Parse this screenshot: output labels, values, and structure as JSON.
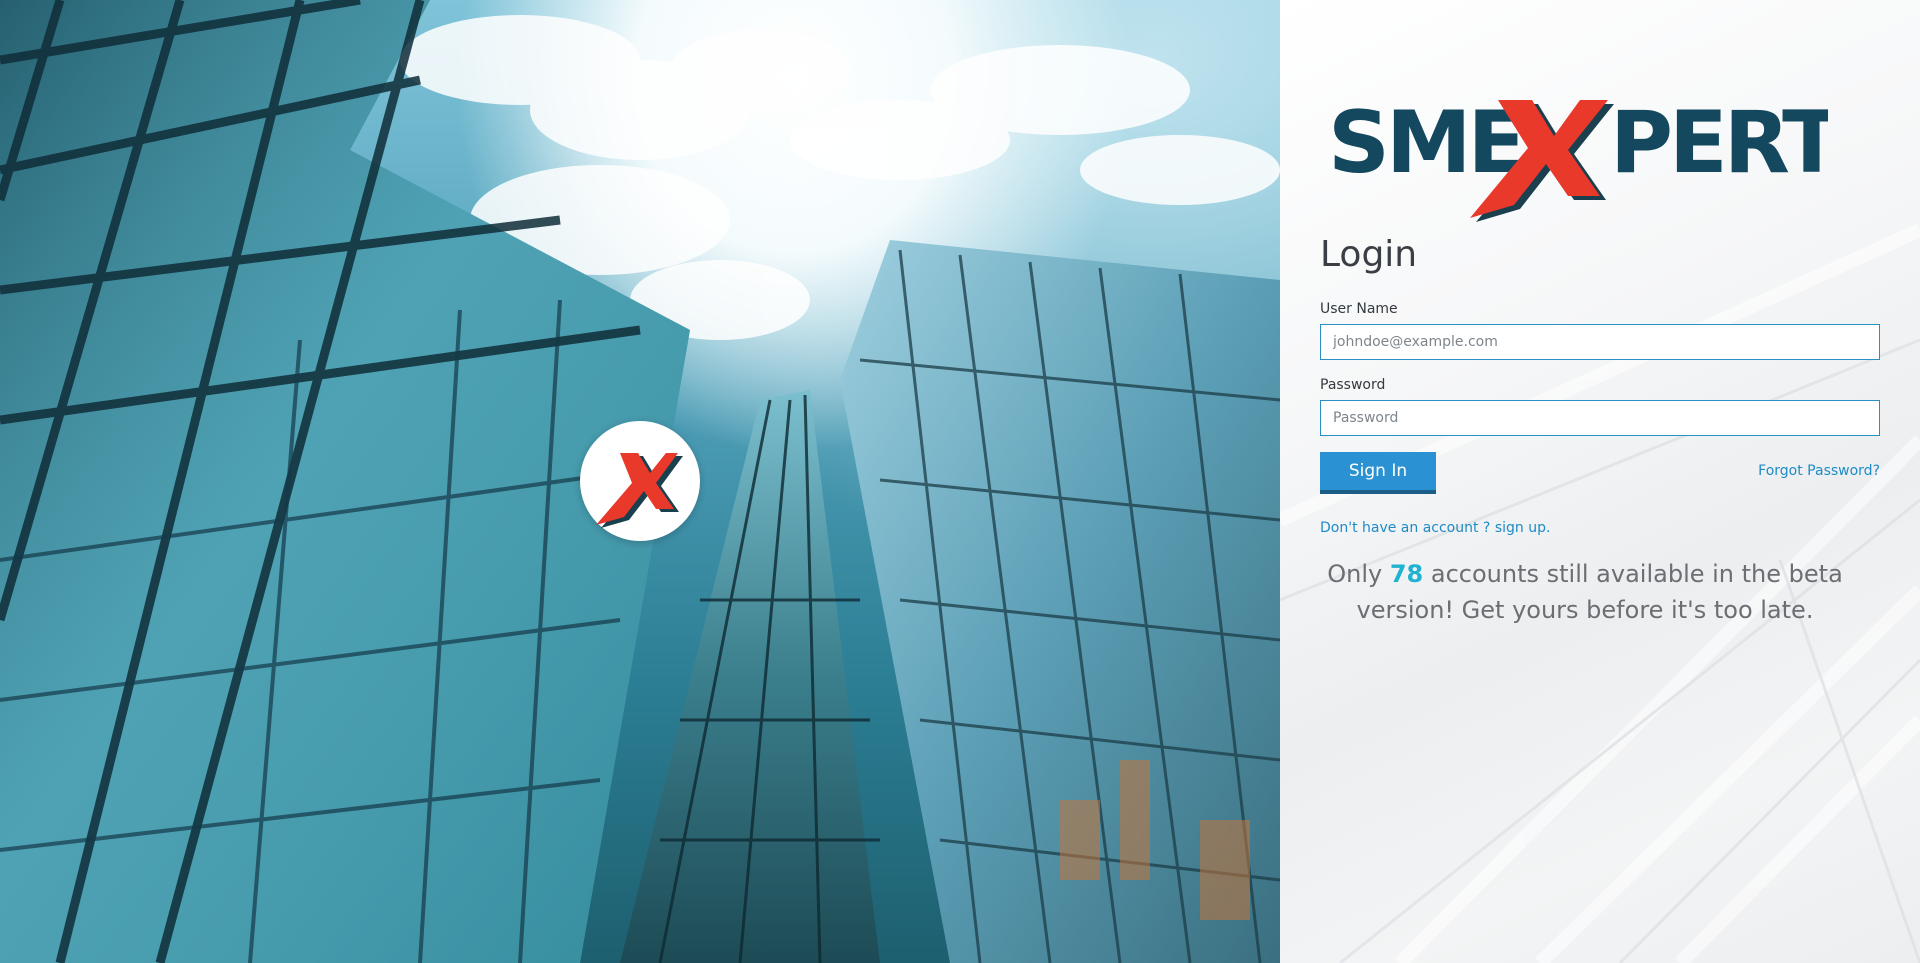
{
  "brand": {
    "logo_text_left": "SME",
    "logo_text_mid": "X",
    "logo_text_right": "PERT",
    "badge_mark": "X",
    "colors": {
      "navy": "#14485e",
      "red": "#e8392b",
      "accent_blue": "#2a92d2",
      "highlight": "#1fb3d1"
    }
  },
  "login": {
    "title": "Login",
    "username_label": "User Name",
    "username_placeholder": "johndoe@example.com",
    "username_value": "",
    "password_label": "Password",
    "password_placeholder": "Password",
    "password_value": "",
    "sign_in_label": "Sign In",
    "forgot_password": "Forgot Password?",
    "signup": "Don't have an account ? sign up."
  },
  "beta_notice": {
    "prefix": "Only",
    "count": "78",
    "suffix": "accounts still available in the beta version! Get yours before it's too late."
  },
  "icons": {
    "hero_badge": "x-logo-icon",
    "brand_logo": "smexpert-logo"
  }
}
